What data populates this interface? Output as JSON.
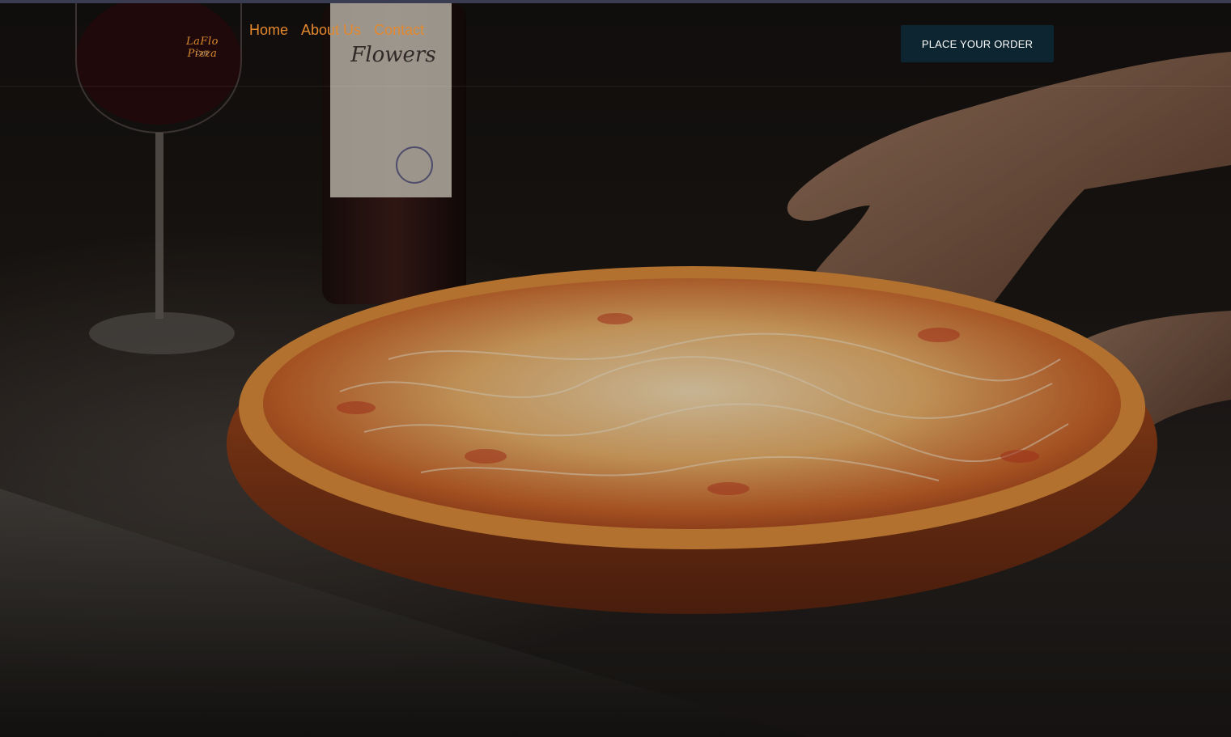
{
  "brand": {
    "logo_text": "LaFlo Pizza",
    "logo_sub": "Café",
    "accent_color": "#e5892f"
  },
  "nav": {
    "items": [
      {
        "label": "Home"
      },
      {
        "label": "About Us"
      },
      {
        "label": "Contact"
      }
    ]
  },
  "header": {
    "cta_label": "PLACE YOUR ORDER",
    "cta_color": "#0d2530"
  },
  "hero": {
    "bottle_label": "Flowers"
  }
}
